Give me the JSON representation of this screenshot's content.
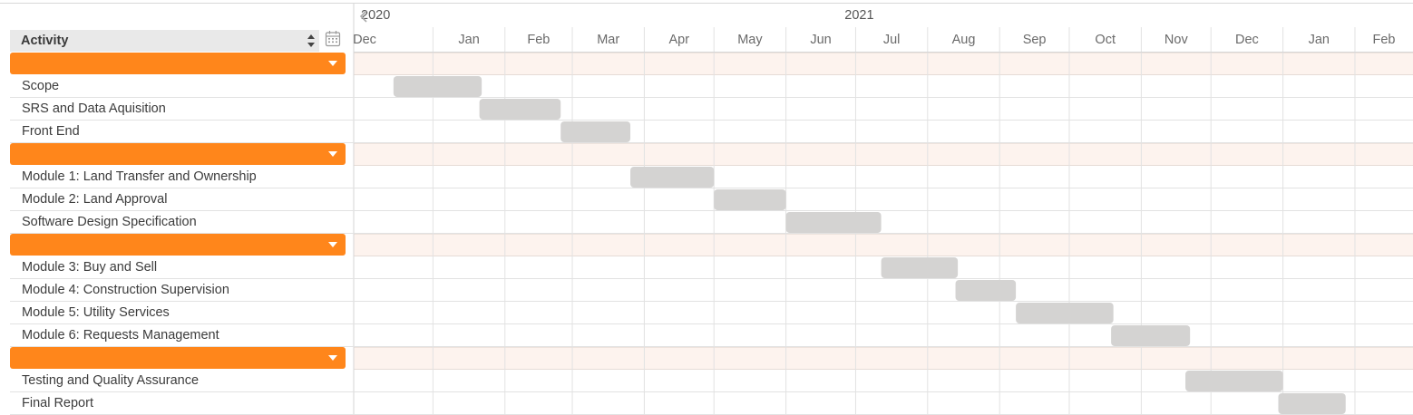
{
  "header": {
    "activity_label": "Activity",
    "sort_icon": "sort-updown-icon",
    "calendar_icon": "calendar-icon",
    "scroll_left_icon": "chevron-left-icon"
  },
  "colors": {
    "group_bar": "#ff861b",
    "group_band": "#fdf3ee",
    "task_bar": "#d4d3d2",
    "grid": "#e2e2e2"
  },
  "chart_data": {
    "type": "gantt",
    "years": [
      {
        "label": "2020",
        "start": "2019-12-01"
      },
      {
        "label": "2021",
        "start": "2020-07-01"
      }
    ],
    "months": [
      {
        "label": "Dec",
        "start": "2019-12-01"
      },
      {
        "label": "Jan",
        "start": "2020-01-01"
      },
      {
        "label": "Feb",
        "start": "2020-02-01"
      },
      {
        "label": "Mar",
        "start": "2020-03-01"
      },
      {
        "label": "Apr",
        "start": "2020-04-01"
      },
      {
        "label": "May",
        "start": "2020-05-01"
      },
      {
        "label": "Jun",
        "start": "2020-06-01"
      },
      {
        "label": "Jul",
        "start": "2020-07-01"
      },
      {
        "label": "Aug",
        "start": "2020-08-01"
      },
      {
        "label": "Sep",
        "start": "2020-09-01"
      },
      {
        "label": "Oct",
        "start": "2020-10-01"
      },
      {
        "label": "Nov",
        "start": "2020-11-01"
      },
      {
        "label": "Dec",
        "start": "2020-12-01"
      },
      {
        "label": "Jan",
        "start": "2021-01-01"
      },
      {
        "label": "Feb",
        "start": "2021-02-01"
      }
    ],
    "rows": [
      {
        "type": "group",
        "name": ""
      },
      {
        "type": "task",
        "name": "Scope",
        "start": "2019-12-15",
        "end": "2020-01-22"
      },
      {
        "type": "task",
        "name": "SRS and  Data Aquisition",
        "start": "2020-01-21",
        "end": "2020-02-25"
      },
      {
        "type": "task",
        "name": "Front End",
        "start": "2020-02-25",
        "end": "2020-03-26"
      },
      {
        "type": "group",
        "name": ""
      },
      {
        "type": "task",
        "name": "Module 1: Land Transfer and Ownership",
        "start": "2020-03-26",
        "end": "2020-05-01"
      },
      {
        "type": "task",
        "name": "Module 2: Land Approval",
        "start": "2020-05-01",
        "end": "2020-06-01"
      },
      {
        "type": "task",
        "name": "Software Design Specification",
        "start": "2020-06-01",
        "end": "2020-07-12"
      },
      {
        "type": "group",
        "name": ""
      },
      {
        "type": "task",
        "name": "Module 3: Buy and Sell",
        "start": "2020-07-12",
        "end": "2020-08-14"
      },
      {
        "type": "task",
        "name": "Module 4: Construction Supervision",
        "start": "2020-08-13",
        "end": "2020-09-08"
      },
      {
        "type": "task",
        "name": "Module 5: Utility Services",
        "start": "2020-09-08",
        "end": "2020-10-20"
      },
      {
        "type": "task",
        "name": "Module 6: Requests Management",
        "start": "2020-10-19",
        "end": "2020-11-22"
      },
      {
        "type": "group",
        "name": ""
      },
      {
        "type": "task",
        "name": "Testing and Quality Assurance",
        "start": "2020-11-20",
        "end": "2021-01-01"
      },
      {
        "type": "task",
        "name": "Final Report",
        "start": "2020-12-30",
        "end": "2021-01-28"
      }
    ]
  }
}
